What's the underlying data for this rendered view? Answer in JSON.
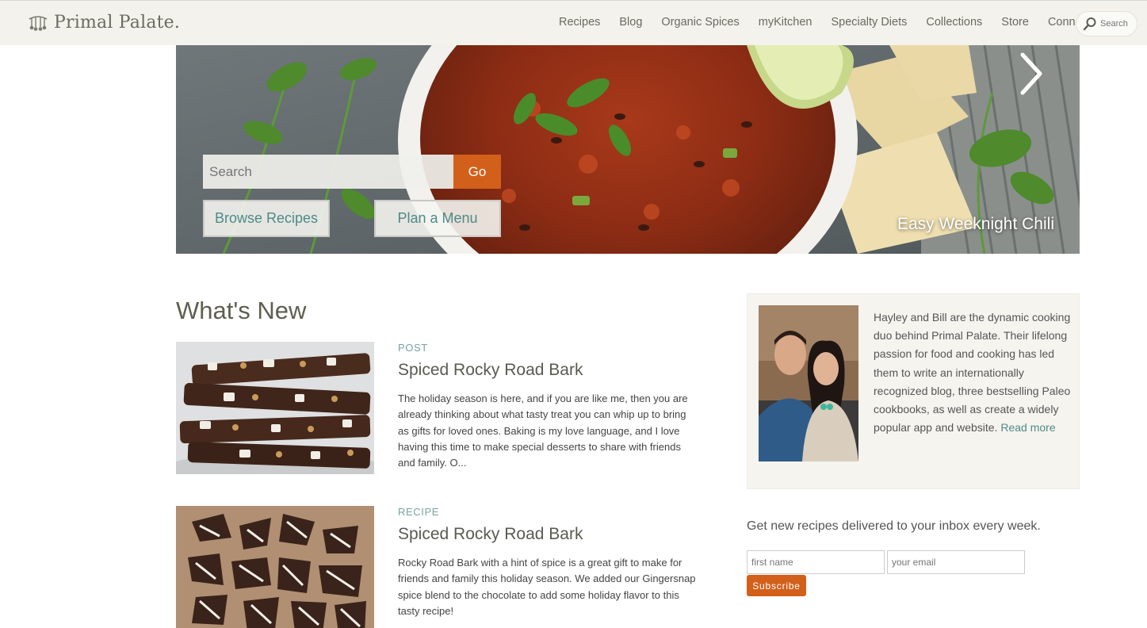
{
  "brand": {
    "name": "Primal Palate.",
    "accent_color": "#d2601a",
    "link_color": "#4f8a86"
  },
  "nav": {
    "items": [
      {
        "label": "Recipes"
      },
      {
        "label": "Blog"
      },
      {
        "label": "Organic Spices"
      },
      {
        "label": "myKitchen"
      },
      {
        "label": "Specialty Diets"
      },
      {
        "label": "Collections"
      },
      {
        "label": "Store"
      },
      {
        "label": "Connect"
      }
    ],
    "search_placeholder": "Search",
    "search_icon": "search-icon"
  },
  "hero": {
    "search_placeholder": "Search",
    "go_label": "Go",
    "browse_label": "Browse Recipes",
    "plan_label": "Plan a Menu",
    "caption": "Easy Weeknight Chili",
    "next_icon": "chevron-right-icon"
  },
  "whats_new": {
    "title": "What's New",
    "items": [
      {
        "kind": "POST",
        "title": "Spiced Rocky Road Bark",
        "description": "The holiday season is here, and if you are like me, then you are already thinking about what tasty treat you can whip up to bring as gifts for loved ones. Baking is my love language, and I love having this time to make special desserts to share with friends and family.   O..."
      },
      {
        "kind": "RECIPE",
        "title": "Spiced Rocky Road Bark",
        "description": "Rocky Road Bark with a hint of spice is a great gift to make for friends and family this holiday season. We added our Gingersnap spice blend to the chocolate to add some holiday flavor to this tasty recipe!"
      }
    ]
  },
  "about": {
    "text": "Hayley and Bill are the dynamic cooking duo behind Primal Palate. Their lifelong passion for food and cooking has led them to write an internationally recognized blog, three bestselling Paleo cookbooks, as well as create a widely popular app and website.",
    "link_label": "Read more"
  },
  "newsletter": {
    "heading": "Get new recipes delivered to your inbox every week.",
    "first_name_placeholder": "first name",
    "email_placeholder": "your email",
    "subscribe_label": "Subscribe"
  }
}
